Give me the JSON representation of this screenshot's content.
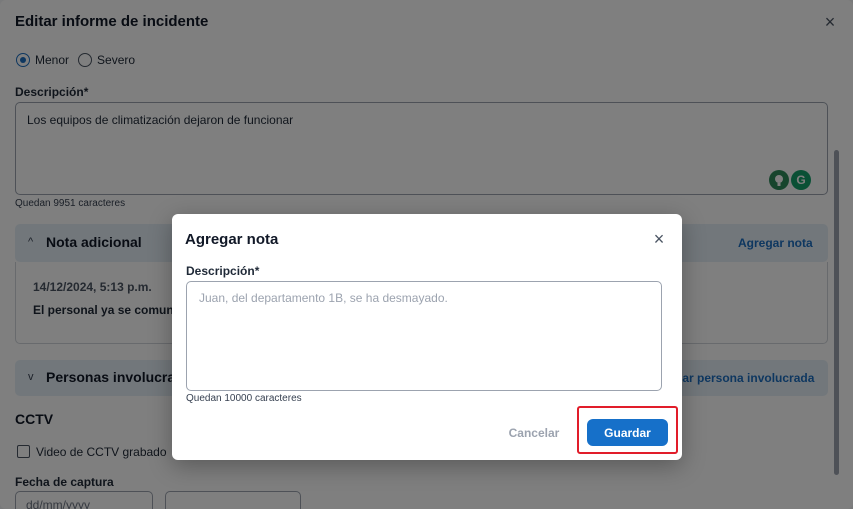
{
  "panel": {
    "title": "Editar informe de incidente",
    "close_glyph": "×",
    "severity": {
      "options": [
        "Menor",
        "Severo"
      ],
      "selected": "Menor"
    },
    "description": {
      "label": "Descripción*",
      "value": "Los equipos de climatización dejaron de funcionar",
      "counter": "Quedan 9951 caracteres"
    },
    "extensions": [
      {
        "icon": "lightbulb-icon",
        "color": "#2f8a5b",
        "glyph": "●"
      },
      {
        "icon": "grammarly-icon",
        "color": "#15a06b",
        "glyph": "G"
      }
    ],
    "additional_note": {
      "title": "Nota adicional",
      "chevron": "^",
      "action": "Agregar nota",
      "entry_date": "14/12/2024, 5:13 p.m.",
      "entry_text": "El personal ya se comunic"
    },
    "people": {
      "title": "Personas involucra",
      "chevron": "v",
      "action": "gar persona involucrada"
    },
    "cctv": {
      "title": "CCTV",
      "checkbox_label": "Video de CCTV grabado",
      "capture_label": "Fecha de captura",
      "date_placeholder": "dd/mm/yyyy"
    }
  },
  "modal": {
    "title": "Agregar nota",
    "close_glyph": "×",
    "field_label": "Descripción*",
    "placeholder": "Juan, del departamento 1B, se ha desmayado.",
    "counter": "Quedan 10000 caracteres",
    "cancel_label": "Cancelar",
    "save_label": "Guardar"
  },
  "colors": {
    "accent": "#1670c9",
    "highlight": "#e11d2a"
  }
}
